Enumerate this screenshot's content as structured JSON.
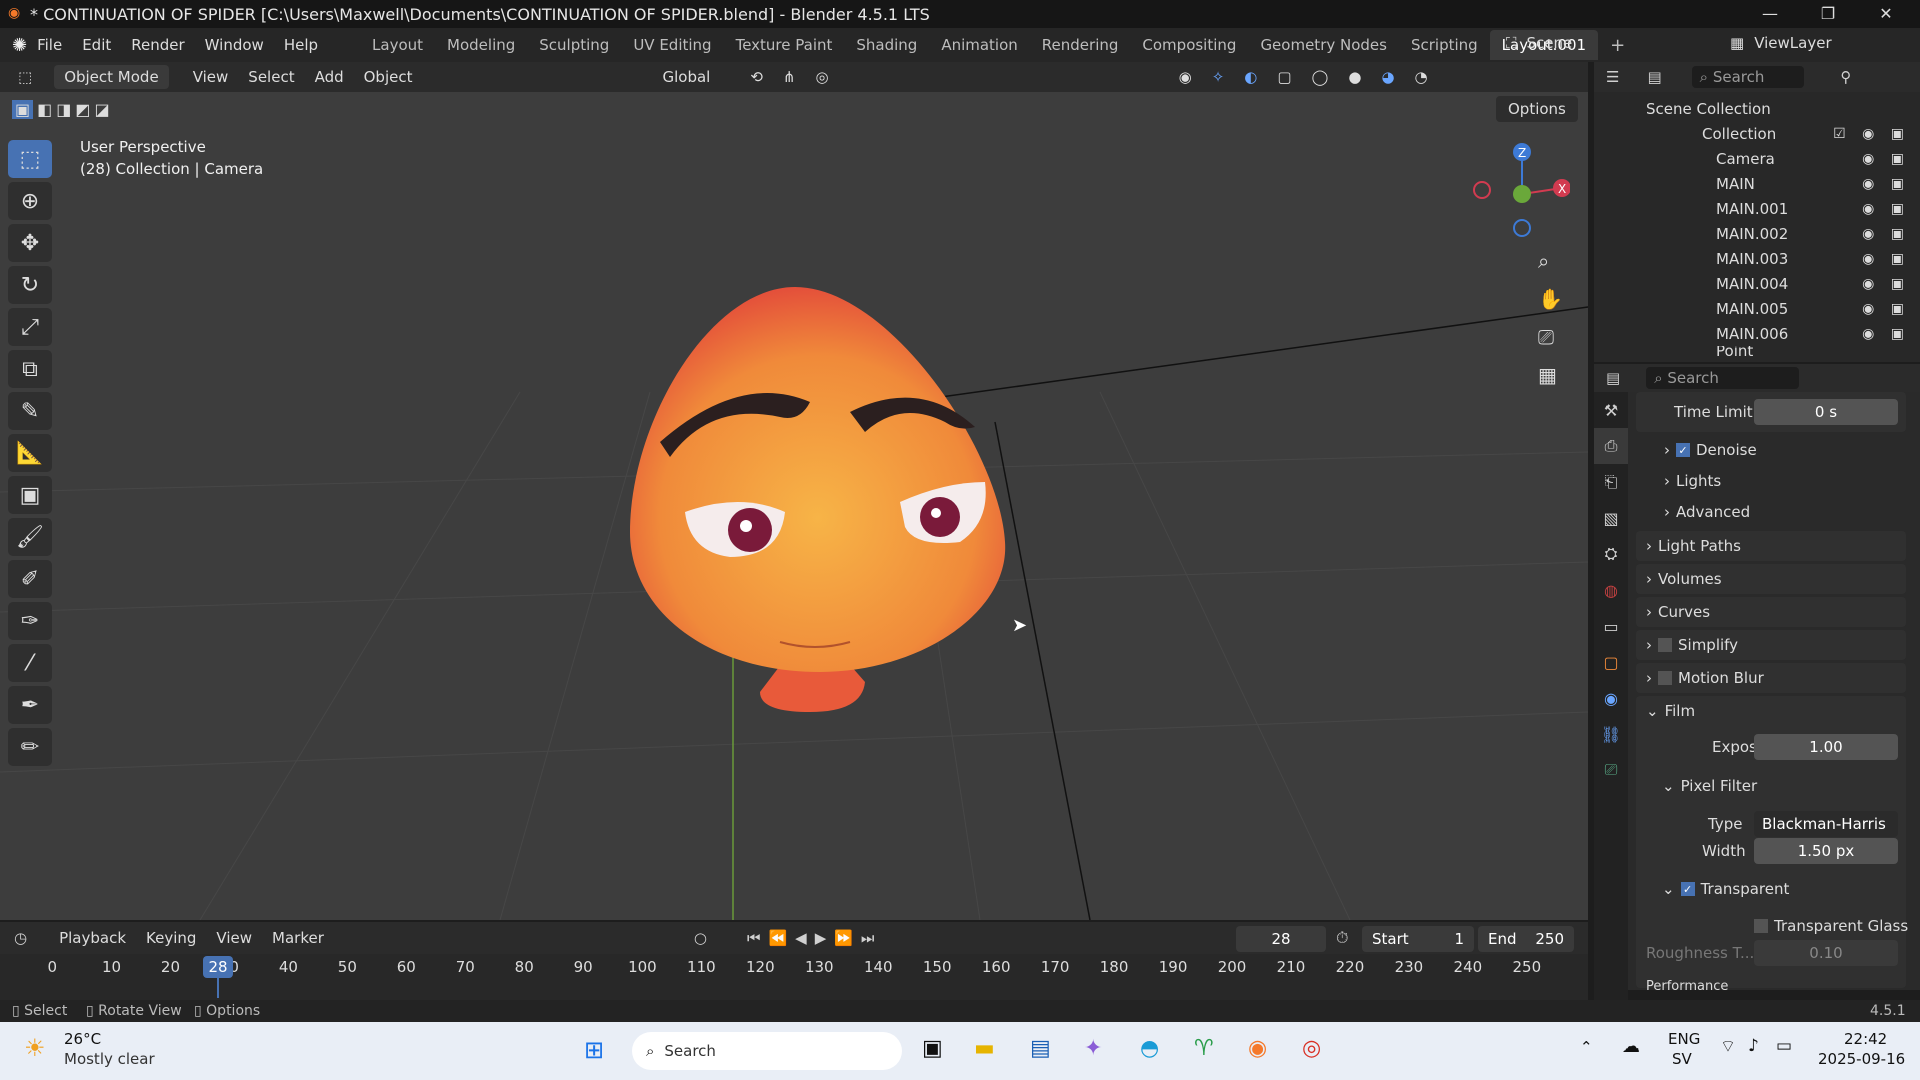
{
  "window": {
    "title": "* CONTINUATION OF SPIDER [C:\\Users\\Maxwell\\Documents\\CONTINUATION OF SPIDER.blend] - Blender 4.5.1 LTS",
    "minimize": "—",
    "maximize": "❐",
    "close": "✕"
  },
  "menu": [
    "File",
    "Edit",
    "Render",
    "Window",
    "Help"
  ],
  "workspaces": [
    "Layout",
    "Modeling",
    "Sculpting",
    "UV Editing",
    "Texture Paint",
    "Shading",
    "Animation",
    "Rendering",
    "Compositing",
    "Geometry Nodes",
    "Scripting",
    "Layout.001"
  ],
  "scene": {
    "name": "Scene",
    "view_layer": "ViewLayer"
  },
  "viewport": {
    "mode": "Object Mode",
    "menus": [
      "View",
      "Select",
      "Add",
      "Object"
    ],
    "transform": "Global",
    "options": "Options",
    "info_line1": "User Perspective",
    "info_line2": "(28) Collection | Camera"
  },
  "outliner": {
    "search": "Search",
    "root": "Scene Collection",
    "collection": "Collection",
    "items": [
      "Camera",
      "MAIN",
      "MAIN.001",
      "MAIN.002",
      "MAIN.003",
      "MAIN.004",
      "MAIN.005",
      "MAIN.006",
      "Point"
    ]
  },
  "properties": {
    "search": "Search",
    "time_limit_label": "Time Limit",
    "time_limit_value": "0 s",
    "denoise": "Denoise",
    "lights": "Lights",
    "advanced": "Advanced",
    "light_paths": "Light Paths",
    "volumes": "Volumes",
    "curves": "Curves",
    "simplify": "Simplify",
    "motion_blur": "Motion Blur",
    "film": "Film",
    "exposure_label": "Exposure",
    "exposure_value": "1.00",
    "pixel_filter": "Pixel Filter",
    "type_label": "Type",
    "type_value": "Blackman-Harris",
    "width_label": "Width",
    "width_value": "1.50 px",
    "transparent": "Transparent",
    "transparent_glass": "Transparent Glass",
    "roughness_label": "Roughness T...",
    "roughness_value": "0.10",
    "performance": "Performance"
  },
  "timeline": {
    "menus": [
      "Playback",
      "Keying",
      "View",
      "Marker"
    ],
    "current_frame": "28",
    "start_label": "Start",
    "start_value": "1",
    "end_label": "End",
    "end_value": "250",
    "ticks": [
      "0",
      "10",
      "20",
      "30",
      "40",
      "50",
      "60",
      "70",
      "80",
      "90",
      "100",
      "110",
      "120",
      "130",
      "140",
      "150",
      "160",
      "170",
      "180",
      "190",
      "200",
      "210",
      "220",
      "230",
      "240",
      "250"
    ],
    "playhead": "28"
  },
  "statusbar": {
    "select": "Select",
    "rotate": "Rotate View",
    "options": "Options",
    "version": "4.5.1"
  },
  "taskbar": {
    "temp": "26°C",
    "weather": "Mostly clear",
    "search": "Search",
    "lang1": "ENG",
    "lang2": "SV",
    "time": "22:42",
    "date": "2025-09-16"
  }
}
